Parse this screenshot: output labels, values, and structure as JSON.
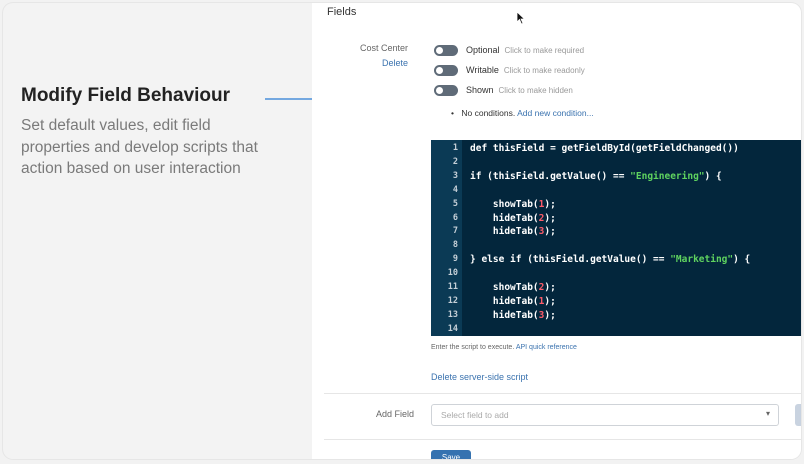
{
  "callout": {
    "title": "Modify Field Behaviour",
    "description": "Set default values, edit field properties and develop scripts that action based on user interaction"
  },
  "panel": {
    "section_label": "Fields",
    "field": {
      "name": "Cost Center",
      "delete_label": "Delete",
      "toggles": [
        {
          "label": "Optional",
          "hint": "Click to make required"
        },
        {
          "label": "Writable",
          "hint": "Click to make readonly"
        },
        {
          "label": "Shown",
          "hint": "Click to make hidden"
        }
      ],
      "conditions": {
        "text": "No conditions.",
        "link": "Add new condition..."
      }
    },
    "script": {
      "lines": [
        [
          {
            "t": "def thisField = getFieldById(getFieldChanged())",
            "c": "kw"
          }
        ],
        [],
        [
          {
            "t": "if (thisField.getValue() == ",
            "c": "kw"
          },
          {
            "t": "\"Engineering\"",
            "c": "str"
          },
          {
            "t": ") {",
            "c": "kw"
          }
        ],
        [],
        [
          {
            "t": "    showTab(",
            "c": "kw"
          },
          {
            "t": "1",
            "c": "num"
          },
          {
            "t": ");",
            "c": "kw"
          }
        ],
        [
          {
            "t": "    hideTab(",
            "c": "kw"
          },
          {
            "t": "2",
            "c": "num"
          },
          {
            "t": ");",
            "c": "kw"
          }
        ],
        [
          {
            "t": "    hideTab(",
            "c": "kw"
          },
          {
            "t": "3",
            "c": "num"
          },
          {
            "t": ");",
            "c": "kw"
          }
        ],
        [],
        [
          {
            "t": "} else if (thisField.getValue() == ",
            "c": "kw"
          },
          {
            "t": "\"Marketing\"",
            "c": "str"
          },
          {
            "t": ") {",
            "c": "kw"
          }
        ],
        [],
        [
          {
            "t": "    showTab(",
            "c": "kw"
          },
          {
            "t": "2",
            "c": "num"
          },
          {
            "t": ");",
            "c": "kw"
          }
        ],
        [
          {
            "t": "    hideTab(",
            "c": "kw"
          },
          {
            "t": "1",
            "c": "num"
          },
          {
            "t": ");",
            "c": "kw"
          }
        ],
        [
          {
            "t": "    hideTab(",
            "c": "kw"
          },
          {
            "t": "3",
            "c": "num"
          },
          {
            "t": ");",
            "c": "kw"
          }
        ],
        []
      ],
      "hint_text": "Enter the script to execute.",
      "hint_link": "API quick reference",
      "delete_label": "Delete server-side script"
    },
    "add_field": {
      "label": "Add Field",
      "placeholder": "Select field to add"
    },
    "save_label": "Save"
  },
  "colors": {
    "editor_bg": "#03263c",
    "gutter_bg": "#0b3a55",
    "string": "#5fd35f",
    "number": "#ff5c6a",
    "link": "#3b73af",
    "accent": "#4a90d9",
    "button": "#3572b0"
  }
}
